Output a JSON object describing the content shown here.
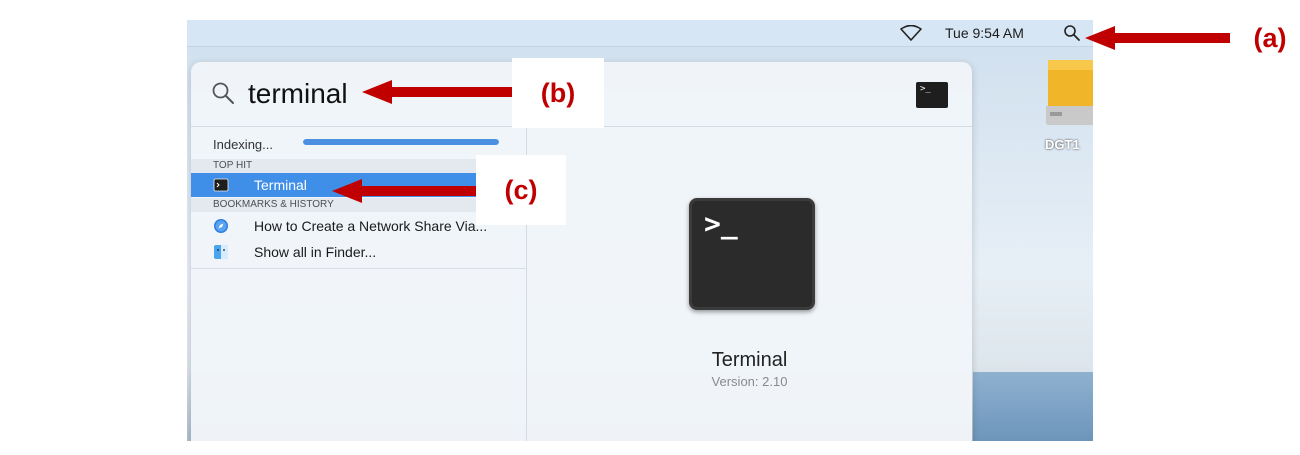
{
  "menubar": {
    "clock": "Tue 9:54 AM",
    "wifi_icon": "wifi-icon",
    "search_icon": "spotlight-search-icon"
  },
  "desktop": {
    "drive_label": "DGT1",
    "drive_icon": "external-drive-icon"
  },
  "spotlight": {
    "query": "terminal",
    "search_icon": "search-icon",
    "indexing": {
      "label": "Indexing...",
      "progress": 1.0
    },
    "sections": [
      {
        "header": "TOP HIT",
        "items": [
          {
            "label": "Terminal",
            "icon": "terminal-icon",
            "selected": true
          }
        ]
      },
      {
        "header": "BOOKMARKS & HISTORY",
        "items": [
          {
            "label": "How to Create a Network Share Via...",
            "icon": "safari-icon",
            "selected": false
          },
          {
            "label": "Show all in Finder...",
            "icon": "finder-icon",
            "selected": false
          }
        ]
      }
    ],
    "preview": {
      "app_name": "Terminal",
      "version": "Version: 2.10",
      "prompt_glyph": ">_"
    }
  },
  "annotations": {
    "a": "(a)",
    "b": "(b)",
    "c": "(c)",
    "color": "#c00000"
  }
}
